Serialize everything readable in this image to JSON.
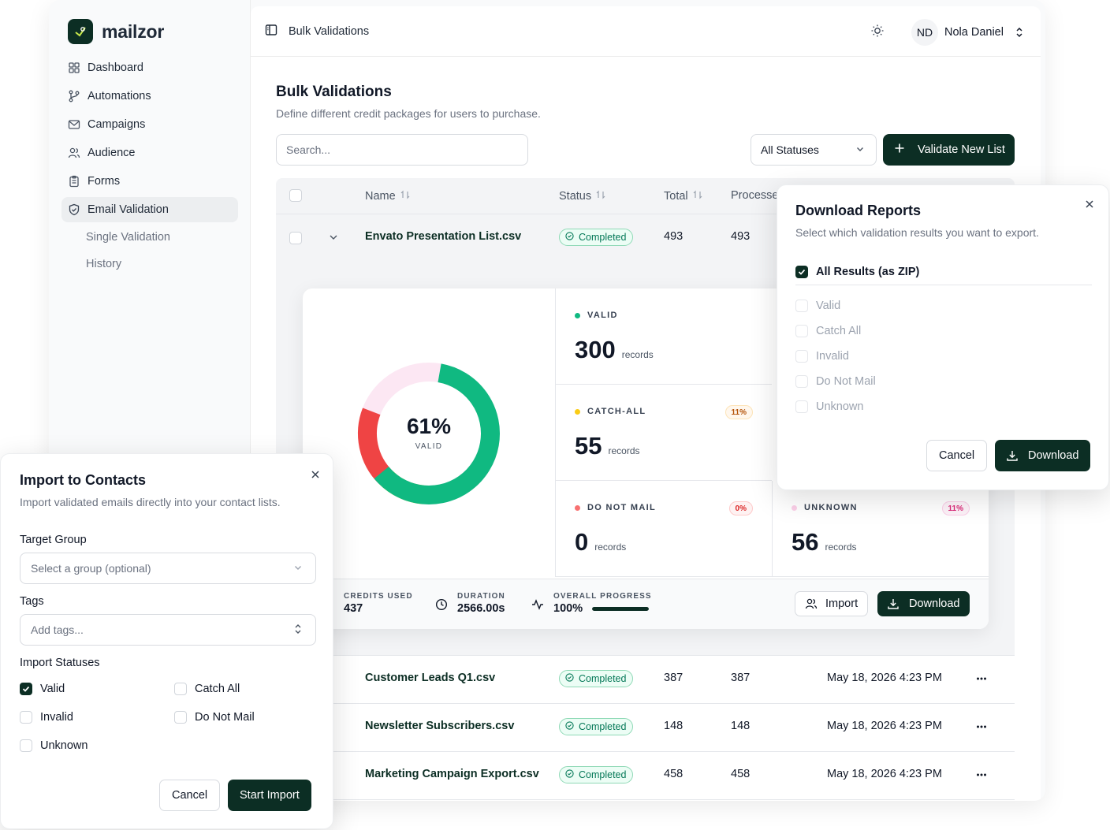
{
  "brand": {
    "name": "mailzor",
    "accent": "#0c2e24"
  },
  "sidebar": {
    "items": [
      {
        "label": "Dashboard",
        "icon": "grid-icon"
      },
      {
        "label": "Automations",
        "icon": "branch-icon"
      },
      {
        "label": "Campaigns",
        "icon": "mail-icon"
      },
      {
        "label": "Audience",
        "icon": "users-icon"
      },
      {
        "label": "Forms",
        "icon": "clipboard-icon"
      },
      {
        "label": "Email Validation",
        "icon": "shield-check-icon",
        "active": true
      }
    ],
    "subitems": [
      {
        "label": "Single Validation"
      },
      {
        "label": "History"
      }
    ]
  },
  "topbar": {
    "breadcrumb": "Bulk Validations",
    "user_initials": "ND",
    "user_name": "Nola Daniel"
  },
  "page": {
    "title": "Bulk Validations",
    "subtitle": "Define different credit packages for users to purchase.",
    "search_placeholder": "Search...",
    "status_filter": "All Statuses",
    "validate_button": "Validate New List"
  },
  "table": {
    "headers": {
      "name": "Name",
      "status": "Status",
      "total": "Total",
      "processed": "Processe"
    },
    "expanded_row": {
      "name": "Envato Presentation List.csv",
      "status": "Completed",
      "total": "493",
      "processed": "493"
    },
    "rows": [
      {
        "name": "Customer Leads Q1.csv",
        "status": "Completed",
        "total": "387",
        "processed": "387",
        "date": "May 18, 2026 4:23 PM"
      },
      {
        "name": "Newsletter Subscribers.csv",
        "status": "Completed",
        "total": "148",
        "processed": "148",
        "date": "May 18, 2026 4:23 PM"
      },
      {
        "name": "Marketing Campaign Export.csv",
        "status": "Completed",
        "total": "458",
        "processed": "458",
        "date": "May 18, 2026 4:23 PM"
      }
    ]
  },
  "details": {
    "donut": {
      "percent": "61%",
      "label": "VALID"
    },
    "stats": {
      "valid": {
        "label": "VALID",
        "value": "300",
        "unit": "records",
        "color": "#10b981"
      },
      "catch_all": {
        "label": "CATCH-ALL",
        "value": "55",
        "unit": "records",
        "pct": "11%",
        "color": "#facc15"
      },
      "do_not_mail": {
        "label": "DO NOT MAIL",
        "value": "0",
        "unit": "records",
        "pct": "0%",
        "color": "#f87171"
      },
      "unknown": {
        "label": "UNKNOWN",
        "value": "56",
        "unit": "records",
        "pct": "11%",
        "color": "#fbcfe8"
      }
    },
    "footer": {
      "credits_label": "CREDITS USED",
      "credits_value": "437",
      "duration_label": "DURATION",
      "duration_value": "2566.00s",
      "progress_label": "OVERALL PROGRESS",
      "progress_value": "100%",
      "progress_fraction": 1.0,
      "import_button": "Import",
      "download_button": "Download"
    }
  },
  "download_modal": {
    "title": "Download Reports",
    "subtitle": "Select which validation results you want to export.",
    "all_results": "All Results (as ZIP)",
    "options": [
      "Valid",
      "Catch All",
      "Invalid",
      "Do Not Mail",
      "Unknown"
    ],
    "cancel": "Cancel",
    "download": "Download"
  },
  "import_modal": {
    "title": "Import to Contacts",
    "subtitle": "Import validated emails directly into your contact lists.",
    "target_group_label": "Target Group",
    "target_group_placeholder": "Select a group (optional)",
    "tags_label": "Tags",
    "tags_placeholder": "Add tags...",
    "statuses_label": "Import Statuses",
    "statuses": {
      "valid": "Valid",
      "catch_all": "Catch All",
      "invalid": "Invalid",
      "do_not_mail": "Do Not Mail",
      "unknown": "Unknown"
    },
    "cancel": "Cancel",
    "start": "Start Import"
  }
}
